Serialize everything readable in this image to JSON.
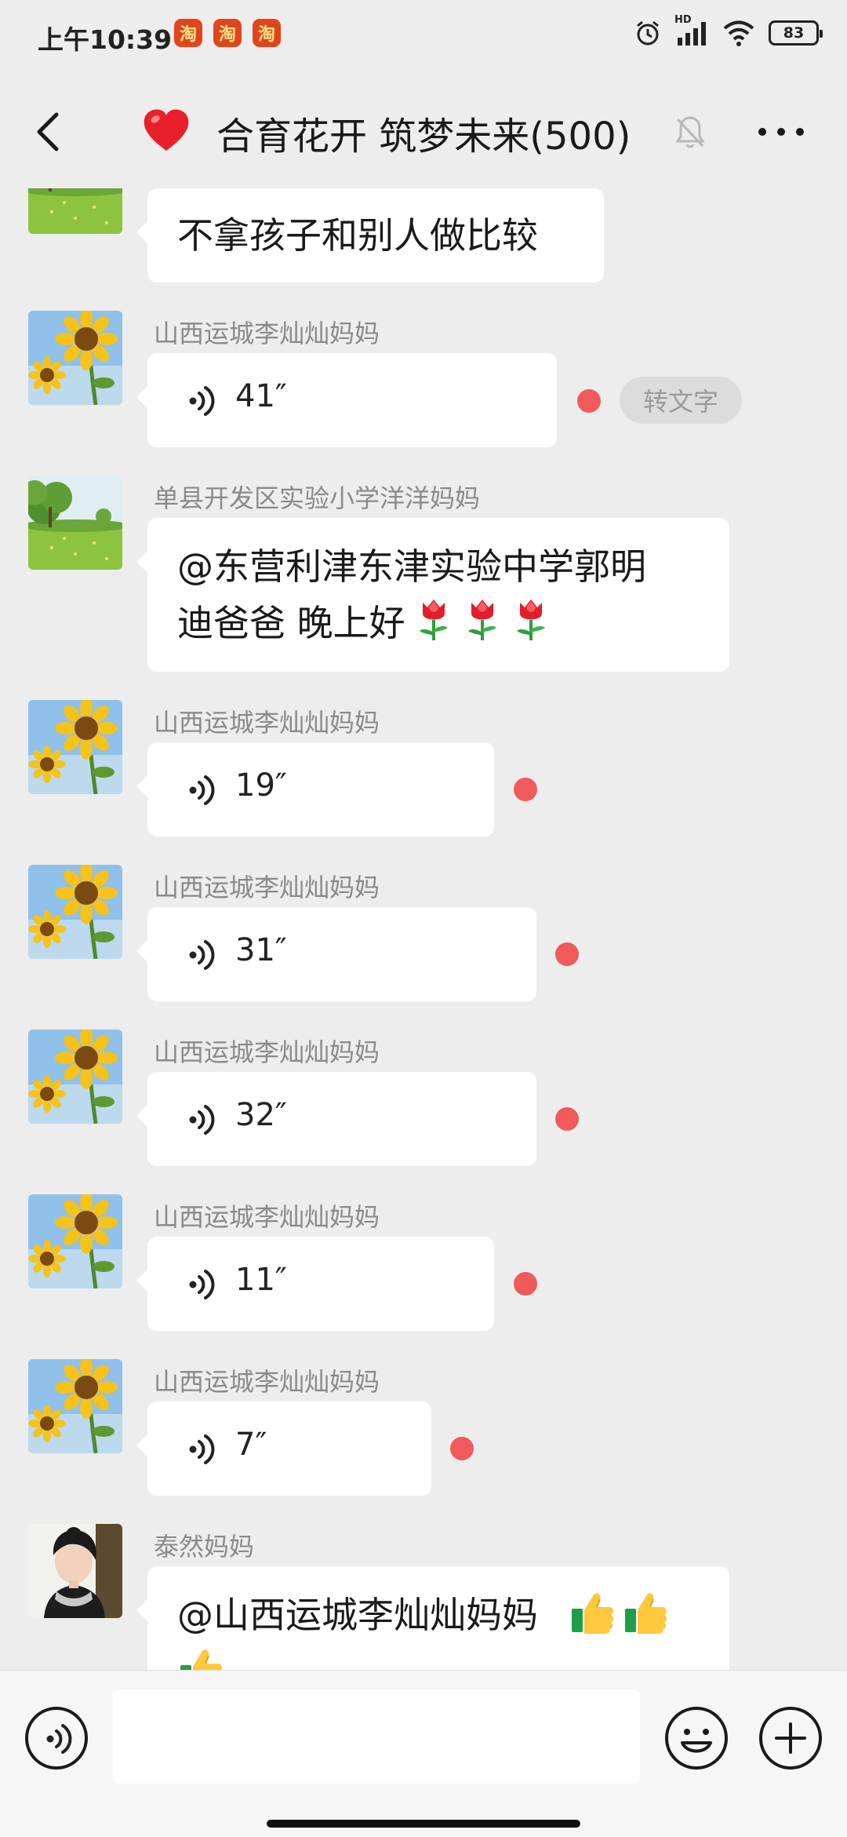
{
  "status_bar": {
    "time": "上午10:39",
    "taobao_badges": [
      "淘",
      "淘",
      "淘"
    ],
    "network": "HD",
    "battery": "83"
  },
  "header": {
    "title": "合育花开 筑梦未来(500)"
  },
  "messages": [
    {
      "type": "text",
      "sender": "",
      "text": "不拿孩子和别人做比较"
    },
    {
      "type": "voice",
      "sender": "山西运城李灿灿妈妈",
      "duration": "41″",
      "unread": true,
      "convert_label": "转文字"
    },
    {
      "type": "text",
      "sender": "单县开发区实验小学洋洋妈妈",
      "line1": "@东营利津东津实验中学郭明",
      "line2": "迪爸爸  晚上好"
    },
    {
      "type": "voice",
      "sender": "山西运城李灿灿妈妈",
      "duration": "19″",
      "unread": true
    },
    {
      "type": "voice",
      "sender": "山西运城李灿灿妈妈",
      "duration": "31″",
      "unread": true
    },
    {
      "type": "voice",
      "sender": "山西运城李灿灿妈妈",
      "duration": "32″",
      "unread": true
    },
    {
      "type": "voice",
      "sender": "山西运城李灿灿妈妈",
      "duration": "11″",
      "unread": true
    },
    {
      "type": "voice",
      "sender": "山西运城李灿灿妈妈",
      "duration": "7″",
      "unread": true
    },
    {
      "type": "text",
      "sender": "泰然妈妈",
      "text": "@山西运城李灿灿妈妈"
    }
  ],
  "input": {
    "placeholder": ""
  },
  "colors": {
    "background": "#ededed",
    "bubble": "#ffffff",
    "unread_dot": "#f05a5a",
    "meta_text": "#8a8a8a"
  },
  "icons": [
    "back-icon",
    "heart-icon",
    "mute-bell-icon",
    "more-icon",
    "voice-wave-icon",
    "smiley-icon",
    "plus-icon",
    "tulip-emoji",
    "thumbs-up-emoji"
  ]
}
